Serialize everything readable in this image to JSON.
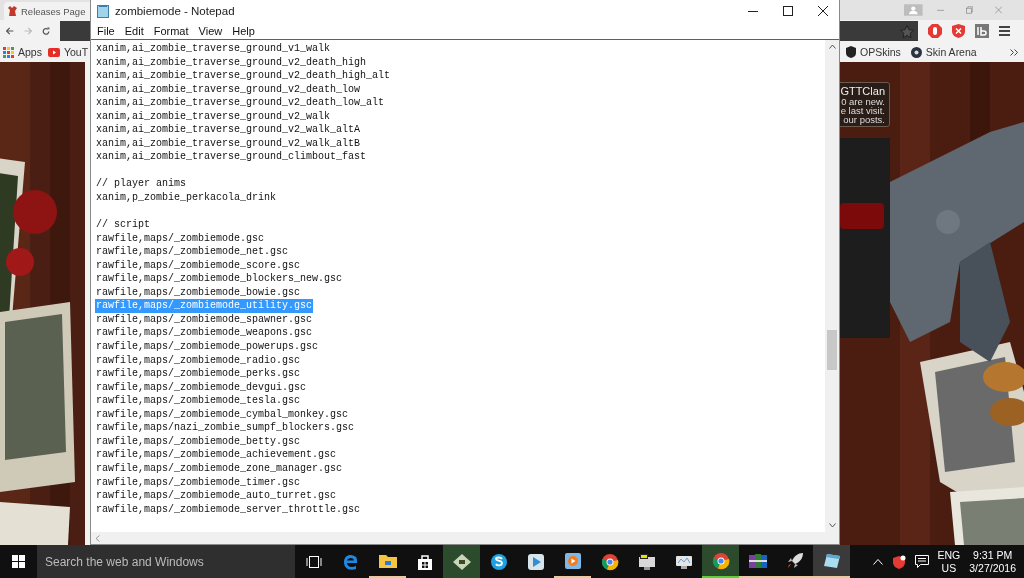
{
  "browser": {
    "tab": {
      "title": "Releases Page"
    },
    "bookmarks_left": [
      {
        "label": "Apps"
      },
      {
        "label": "YouT"
      }
    ],
    "bookmarks_right": [
      {
        "label": "OPSkins"
      },
      {
        "label": "Skin Arena"
      }
    ],
    "notice": [
      "GTTClan",
      "0 are new.",
      "e last visit.",
      "our posts."
    ]
  },
  "notepad": {
    "title": "zombiemode - Notepad",
    "menu": [
      "File",
      "Edit",
      "Format",
      "View",
      "Help"
    ],
    "sections": [
      {
        "lines": [
          {
            "text": "xanim,ai_zombie_traverse_ground_v1_walk",
            "selected": false
          },
          {
            "text": "xanim,ai_zombie_traverse_ground_v2_death_high",
            "selected": false
          },
          {
            "text": "xanim,ai_zombie_traverse_ground_v2_death_high_alt",
            "selected": false
          },
          {
            "text": "xanim,ai_zombie_traverse_ground_v2_death_low",
            "selected": false
          },
          {
            "text": "xanim,ai_zombie_traverse_ground_v2_death_low_alt",
            "selected": false
          },
          {
            "text": "xanim,ai_zombie_traverse_ground_v2_walk",
            "selected": false
          },
          {
            "text": "xanim,ai_zombie_traverse_ground_v2_walk_altA",
            "selected": false
          },
          {
            "text": "xanim,ai_zombie_traverse_ground_v2_walk_altB",
            "selected": false
          },
          {
            "text": "xanim,ai_zombie_traverse_ground_climbout_fast",
            "selected": false
          }
        ]
      },
      {
        "lines": [
          {
            "text": "// player anims",
            "selected": false
          },
          {
            "text": "xanim,p_zombie_perkacola_drink",
            "selected": false
          }
        ]
      },
      {
        "lines": [
          {
            "text": "// script",
            "selected": false
          },
          {
            "text": "rawfile,maps/_zombiemode.gsc",
            "selected": false
          },
          {
            "text": "rawfile,maps/_zombiemode_net.gsc",
            "selected": false
          },
          {
            "text": "rawfile,maps/_zombiemode_score.gsc",
            "selected": false
          },
          {
            "text": "rawfile,maps/_zombiemode_blockers_new.gsc",
            "selected": false
          },
          {
            "text": "rawfile,maps/_zombiemode_bowie.gsc",
            "selected": false
          },
          {
            "text": "rawfile,maps/_zombiemode_utility.gsc",
            "selected": true
          },
          {
            "text": "rawfile,maps/_zombiemode_spawner.gsc",
            "selected": false
          },
          {
            "text": "rawfile,maps/_zombiemode_weapons.gsc",
            "selected": false
          },
          {
            "text": "rawfile,maps/_zombiemode_powerups.gsc",
            "selected": false
          },
          {
            "text": "rawfile,maps/_zombiemode_radio.gsc",
            "selected": false
          },
          {
            "text": "rawfile,maps/_zombiemode_perks.gsc",
            "selected": false
          },
          {
            "text": "rawfile,maps/_zombiemode_devgui.gsc",
            "selected": false
          },
          {
            "text": "rawfile,maps/_zombiemode_tesla.gsc",
            "selected": false
          },
          {
            "text": "rawfile,maps/_zombiemode_cymbal_monkey.gsc",
            "selected": false
          },
          {
            "text": "rawfile,maps/nazi_zombie_sumpf_blockers.gsc",
            "selected": false
          },
          {
            "text": "rawfile,maps/_zombiemode_betty.gsc",
            "selected": false
          },
          {
            "text": "rawfile,maps/_zombiemode_achievement.gsc",
            "selected": false
          },
          {
            "text": "rawfile,maps/_zombiemode_zone_manager.gsc",
            "selected": false
          },
          {
            "text": "rawfile,maps/_zombiemode_timer.gsc",
            "selected": false
          },
          {
            "text": "rawfile,maps/_zombiemode_auto_turret.gsc",
            "selected": false
          },
          {
            "text": "rawfile,maps/_zombiemode_server_throttle.gsc",
            "selected": false
          }
        ]
      }
    ]
  },
  "taskbar": {
    "search": {
      "placeholder": "Search the web and Windows"
    },
    "language": "ENG",
    "region": "US",
    "time": "9:31 PM",
    "date": "3/27/2016"
  }
}
